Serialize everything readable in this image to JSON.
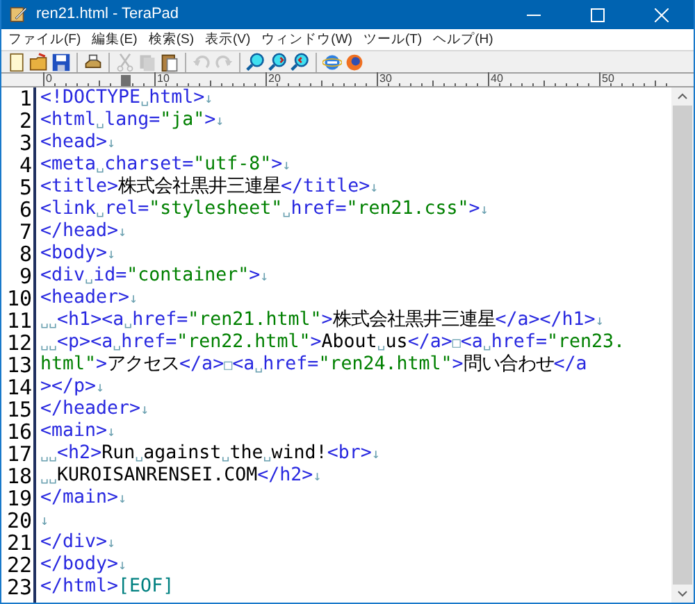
{
  "window": {
    "title": "ren21.html - TeraPad"
  },
  "menu": [
    "ファイル(F)",
    "編集(E)",
    "検索(S)",
    "表示(V)",
    "ウィンドウ(W)",
    "ツール(T)",
    "ヘルプ(H)"
  ],
  "toolbar": [
    {
      "kind": "new",
      "disabled": false
    },
    {
      "kind": "open",
      "disabled": false
    },
    {
      "kind": "save",
      "disabled": false
    },
    {
      "kind": "sep"
    },
    {
      "kind": "print",
      "disabled": false
    },
    {
      "kind": "sep"
    },
    {
      "kind": "cut",
      "disabled": true
    },
    {
      "kind": "copy",
      "disabled": true
    },
    {
      "kind": "paste",
      "disabled": false
    },
    {
      "kind": "sep"
    },
    {
      "kind": "undo",
      "disabled": true
    },
    {
      "kind": "redo",
      "disabled": true
    },
    {
      "kind": "sep"
    },
    {
      "kind": "find",
      "disabled": false
    },
    {
      "kind": "find-next",
      "disabled": false
    },
    {
      "kind": "find-prev",
      "disabled": false
    },
    {
      "kind": "sep"
    },
    {
      "kind": "globe",
      "disabled": false
    },
    {
      "kind": "fox",
      "disabled": false
    }
  ],
  "ruler": {
    "labels": [
      "0",
      "10",
      "20",
      "30",
      "40",
      "50"
    ]
  },
  "lines": [
    {
      "number": "1",
      "tokens": [
        {
          "kind": "tag",
          "text": "<!DOCTYPE"
        },
        {
          "kind": "mark",
          "text": "␣"
        },
        {
          "kind": "tag",
          "text": "html>"
        },
        {
          "kind": "mark",
          "text": "↓"
        }
      ]
    },
    {
      "number": "2",
      "tokens": [
        {
          "kind": "tag",
          "text": "<html"
        },
        {
          "kind": "mark",
          "text": "␣"
        },
        {
          "kind": "tag",
          "text": "lang="
        },
        {
          "kind": "str",
          "text": "\"ja\""
        },
        {
          "kind": "tag",
          "text": ">"
        },
        {
          "kind": "mark",
          "text": "↓"
        }
      ]
    },
    {
      "number": "3",
      "tokens": [
        {
          "kind": "tag",
          "text": "<head>"
        },
        {
          "kind": "mark",
          "text": "↓"
        }
      ]
    },
    {
      "number": "4",
      "tokens": [
        {
          "kind": "tag",
          "text": "<meta"
        },
        {
          "kind": "mark",
          "text": "␣"
        },
        {
          "kind": "tag",
          "text": "charset="
        },
        {
          "kind": "str",
          "text": "\"utf-8\""
        },
        {
          "kind": "tag",
          "text": ">"
        },
        {
          "kind": "mark",
          "text": "↓"
        }
      ]
    },
    {
      "number": "5",
      "tokens": [
        {
          "kind": "tag",
          "text": "<title>"
        },
        {
          "kind": "text",
          "text": "株式会社黒井三連星"
        },
        {
          "kind": "tag",
          "text": "</title>"
        },
        {
          "kind": "mark",
          "text": "↓"
        }
      ]
    },
    {
      "number": "6",
      "tokens": [
        {
          "kind": "tag",
          "text": "<link"
        },
        {
          "kind": "mark",
          "text": "␣"
        },
        {
          "kind": "tag",
          "text": "rel="
        },
        {
          "kind": "str",
          "text": "\"stylesheet\""
        },
        {
          "kind": "mark",
          "text": "␣"
        },
        {
          "kind": "tag",
          "text": "href="
        },
        {
          "kind": "str",
          "text": "\"ren21.css\""
        },
        {
          "kind": "tag",
          "text": ">"
        },
        {
          "kind": "mark",
          "text": "↓"
        }
      ]
    },
    {
      "number": "7",
      "tokens": [
        {
          "kind": "tag",
          "text": "</head>"
        },
        {
          "kind": "mark",
          "text": "↓"
        }
      ]
    },
    {
      "number": "8",
      "tokens": [
        {
          "kind": "tag",
          "text": "<body>"
        },
        {
          "kind": "mark",
          "text": "↓"
        }
      ]
    },
    {
      "number": "9",
      "tokens": [
        {
          "kind": "tag",
          "text": "<div"
        },
        {
          "kind": "mark",
          "text": "␣"
        },
        {
          "kind": "tag",
          "text": "id="
        },
        {
          "kind": "str",
          "text": "\"container\""
        },
        {
          "kind": "tag",
          "text": ">"
        },
        {
          "kind": "mark",
          "text": "↓"
        }
      ]
    },
    {
      "number": "10",
      "tokens": [
        {
          "kind": "tag",
          "text": "<header>"
        },
        {
          "kind": "mark",
          "text": "↓"
        }
      ]
    },
    {
      "number": "11",
      "tokens": [
        {
          "kind": "mark",
          "text": "␣␣"
        },
        {
          "kind": "tag",
          "text": "<h1><a"
        },
        {
          "kind": "mark",
          "text": "␣"
        },
        {
          "kind": "tag",
          "text": "href="
        },
        {
          "kind": "str",
          "text": "\"ren21.html\""
        },
        {
          "kind": "tag",
          "text": ">"
        },
        {
          "kind": "text",
          "text": "株式会社黒井三連星"
        },
        {
          "kind": "tag",
          "text": "</a></h1>"
        },
        {
          "kind": "mark",
          "text": "↓"
        }
      ]
    },
    {
      "number": "12",
      "tokens": [
        {
          "kind": "mark",
          "text": "␣␣"
        },
        {
          "kind": "tag",
          "text": "<p><a"
        },
        {
          "kind": "mark",
          "text": "␣"
        },
        {
          "kind": "tag",
          "text": "href="
        },
        {
          "kind": "str",
          "text": "\"ren22.html\""
        },
        {
          "kind": "tag",
          "text": ">"
        },
        {
          "kind": "text",
          "text": "About"
        },
        {
          "kind": "mark",
          "text": "␣"
        },
        {
          "kind": "text",
          "text": "us"
        },
        {
          "kind": "tag",
          "text": "</a>"
        },
        {
          "kind": "mark",
          "text": "□"
        },
        {
          "kind": "tag",
          "text": "<a"
        },
        {
          "kind": "mark",
          "text": "␣"
        },
        {
          "kind": "tag",
          "text": "href="
        },
        {
          "kind": "str",
          "text": "\"ren23."
        }
      ]
    },
    {
      "number": "13",
      "tokens": [
        {
          "kind": "str",
          "text": "html\""
        },
        {
          "kind": "tag",
          "text": ">"
        },
        {
          "kind": "text",
          "text": "アクセス"
        },
        {
          "kind": "tag",
          "text": "</a>"
        },
        {
          "kind": "mark",
          "text": "□"
        },
        {
          "kind": "tag",
          "text": "<a"
        },
        {
          "kind": "mark",
          "text": "␣"
        },
        {
          "kind": "tag",
          "text": "href="
        },
        {
          "kind": "str",
          "text": "\"ren24.html\""
        },
        {
          "kind": "tag",
          "text": ">"
        },
        {
          "kind": "text",
          "text": "問い合わせ"
        },
        {
          "kind": "tag",
          "text": "</a"
        }
      ]
    },
    {
      "number": "14",
      "tokens": [
        {
          "kind": "tag",
          "text": "></p>"
        },
        {
          "kind": "mark",
          "text": "↓"
        }
      ]
    },
    {
      "number": "15",
      "tokens": [
        {
          "kind": "tag",
          "text": "</header>"
        },
        {
          "kind": "mark",
          "text": "↓"
        }
      ]
    },
    {
      "number": "16",
      "tokens": [
        {
          "kind": "tag",
          "text": "<main>"
        },
        {
          "kind": "mark",
          "text": "↓"
        }
      ]
    },
    {
      "number": "17",
      "tokens": [
        {
          "kind": "mark",
          "text": "␣␣"
        },
        {
          "kind": "tag",
          "text": "<h2>"
        },
        {
          "kind": "text",
          "text": "Run"
        },
        {
          "kind": "mark",
          "text": "␣"
        },
        {
          "kind": "text",
          "text": "against"
        },
        {
          "kind": "mark",
          "text": "␣"
        },
        {
          "kind": "text",
          "text": "the"
        },
        {
          "kind": "mark",
          "text": "␣"
        },
        {
          "kind": "text",
          "text": "wind!"
        },
        {
          "kind": "tag",
          "text": "<br>"
        },
        {
          "kind": "mark",
          "text": "↓"
        }
      ]
    },
    {
      "number": "18",
      "tokens": [
        {
          "kind": "mark",
          "text": "␣␣"
        },
        {
          "kind": "text",
          "text": "KUROISANRENSEI.COM"
        },
        {
          "kind": "tag",
          "text": "</h2>"
        },
        {
          "kind": "mark",
          "text": "↓"
        }
      ]
    },
    {
      "number": "19",
      "tokens": [
        {
          "kind": "tag",
          "text": "</main>"
        },
        {
          "kind": "mark",
          "text": "↓"
        }
      ]
    },
    {
      "number": "20",
      "tokens": [
        {
          "kind": "mark",
          "text": "↓"
        }
      ]
    },
    {
      "number": "21",
      "tokens": [
        {
          "kind": "tag",
          "text": "</div>"
        },
        {
          "kind": "mark",
          "text": "↓"
        }
      ]
    },
    {
      "number": "22",
      "tokens": [
        {
          "kind": "tag",
          "text": "</body>"
        },
        {
          "kind": "mark",
          "text": "↓"
        }
      ]
    },
    {
      "number": "23",
      "tokens": [
        {
          "kind": "tag",
          "text": "</html>"
        },
        {
          "kind": "eof",
          "text": "[EOF]"
        }
      ]
    }
  ]
}
